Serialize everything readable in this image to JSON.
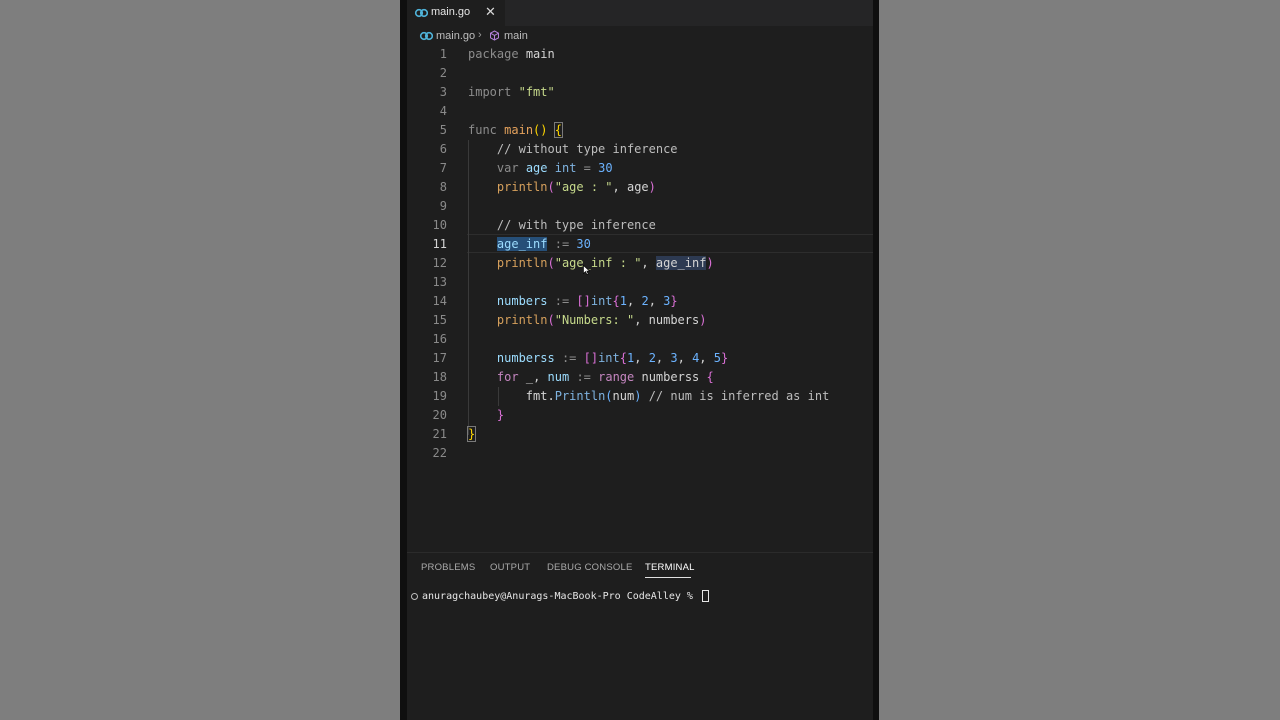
{
  "tab": {
    "label": "main.go"
  },
  "breadcrumb": {
    "file": "main.go",
    "symbol": "main"
  },
  "code": {
    "line_numbers": [
      "1",
      "2",
      "3",
      "4",
      "5",
      "6",
      "7",
      "8",
      "9",
      "10",
      "11",
      "12",
      "13",
      "14",
      "15",
      "16",
      "17",
      "18",
      "19",
      "20",
      "21",
      "22"
    ],
    "active_line": "11",
    "l1": {
      "kw": "package",
      "name": "main"
    },
    "l3": {
      "kw": "import",
      "str": "\"fmt\""
    },
    "l5": {
      "kw": "func",
      "fn": "main",
      "open": "()",
      "brace": "{"
    },
    "l6": {
      "comment": "// without type inference"
    },
    "l7": {
      "kw": "var",
      "name": "age",
      "type": "int",
      "op": "=",
      "num": "30"
    },
    "l8": {
      "fn": "println",
      "open": "(",
      "str": "\"age : \"",
      "sep": ", ",
      "arg": "age",
      "close": ")"
    },
    "l10": {
      "comment": "// with type inference"
    },
    "l11": {
      "name": "age_inf",
      "op": ":=",
      "num": "30"
    },
    "l12": {
      "fn": "println",
      "open": "(",
      "str": "\"age_inf : \"",
      "sep": ", ",
      "arg": "age_inf",
      "close": ")"
    },
    "l14": {
      "name": "numbers",
      "op": ":=",
      "bracket": "[]",
      "type": "int",
      "open": "{",
      "n1": "1",
      "n2": "2",
      "n3": "3",
      "close": "}"
    },
    "l15": {
      "fn": "println",
      "open": "(",
      "str": "\"Numbers: \"",
      "sep": ", ",
      "arg": "numbers",
      "close": ")"
    },
    "l17": {
      "name": "numberss",
      "op": ":=",
      "bracket": "[]",
      "type": "int",
      "open": "{",
      "n1": "1",
      "n2": "2",
      "n3": "3",
      "n4": "4",
      "n5": "5",
      "close": "}"
    },
    "l18": {
      "kw": "for",
      "blank": "_",
      "var": "num",
      "op": ":=",
      "range": "range",
      "arg": "numberss",
      "brace": "{"
    },
    "l19": {
      "pkg": "fmt",
      "fn": "Println",
      "open": "(",
      "arg": "num",
      "close": ")",
      "comment": "// num is inferred as int"
    },
    "l20": {
      "brace": "}"
    },
    "l21": {
      "brace": "}"
    }
  },
  "panel": {
    "tabs": [
      "PROBLEMS",
      "OUTPUT",
      "DEBUG CONSOLE",
      "TERMINAL"
    ],
    "active_tab": "TERMINAL",
    "terminal_prompt": "anuragchaubey@Anurags-MacBook-Pro CodeAlley % "
  },
  "colors": {
    "editor_bg": "#1e1e1e",
    "selection": "#264f78",
    "go_icon": "#4fb3d9"
  }
}
